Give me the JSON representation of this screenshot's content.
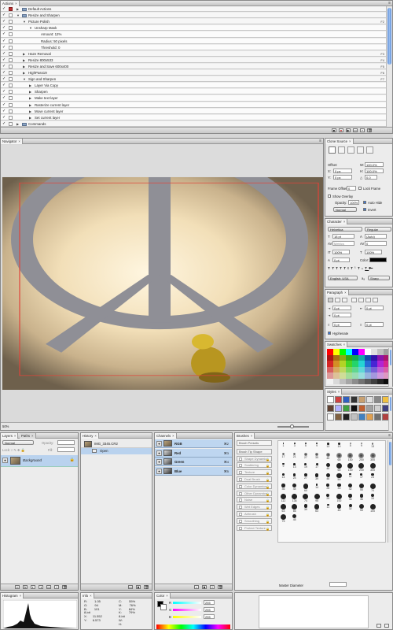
{
  "actions": {
    "tab": "Actions",
    "rows": [
      {
        "label": "Default Actions",
        "indent": 0,
        "type": "set",
        "key": ""
      },
      {
        "label": "Resize and Sharpen",
        "indent": 0,
        "type": "set",
        "key": ""
      },
      {
        "label": "Picture Polish",
        "indent": 1,
        "type": "action",
        "key": "F2"
      },
      {
        "label": "Unsharp Mask",
        "indent": 2,
        "type": "step",
        "key": ""
      },
      {
        "label": "Amount: 12%",
        "indent": 3,
        "type": "param",
        "key": ""
      },
      {
        "label": "Radius: 50 pixels",
        "indent": 3,
        "type": "param",
        "key": ""
      },
      {
        "label": "Threshold: 0",
        "indent": 3,
        "type": "param",
        "key": ""
      },
      {
        "label": "Haze Removal",
        "indent": 1,
        "type": "action",
        "key": "F3"
      },
      {
        "label": "Resize 800x533",
        "indent": 1,
        "type": "action",
        "key": "F4"
      },
      {
        "label": "Resize and Save 600x400",
        "indent": 1,
        "type": "action",
        "key": "F5"
      },
      {
        "label": "HighPass19",
        "indent": 1,
        "type": "action",
        "key": "F6"
      },
      {
        "label": "Sign and Sharpen",
        "indent": 1,
        "type": "action",
        "key": "F7"
      },
      {
        "label": "Layer Via Copy",
        "indent": 2,
        "type": "step",
        "key": ""
      },
      {
        "label": "Sharpen",
        "indent": 2,
        "type": "step",
        "key": ""
      },
      {
        "label": "Make text layer",
        "indent": 2,
        "type": "step",
        "key": ""
      },
      {
        "label": "Rasterize current layer",
        "indent": 2,
        "type": "step",
        "key": ""
      },
      {
        "label": "Move current layer",
        "indent": 2,
        "type": "step",
        "key": ""
      },
      {
        "label": "Set current layer",
        "indent": 2,
        "type": "step",
        "key": ""
      },
      {
        "label": "Commands",
        "indent": 0,
        "type": "set",
        "key": ""
      }
    ]
  },
  "document": {
    "tab": "Navigator",
    "zoom": "50%"
  },
  "clone_source": {
    "tab": "Clone Source",
    "offset_label": "Offset:",
    "x": "0 px",
    "y": "0 px",
    "w": "100.0%",
    "h": "100.0%",
    "angle": "0.0",
    "frame_offset_label": "Frame Offset:",
    "frame_offset": "0",
    "lock_frame": "Lock Frame",
    "show_overlay": "Show Overlay",
    "opacity_label": "Opacity:",
    "opacity": "100%",
    "auto_hide": "Auto Hide",
    "mode": "Normal",
    "invert": "Invert"
  },
  "character": {
    "tab": "Character",
    "font": "Helvetica",
    "style": "Regular",
    "size": "18 pt",
    "leading": "(Auto)",
    "kerning": "Metrics",
    "tracking": "0",
    "vscale": "100%",
    "hscale": "100%",
    "baseline": "0 pt",
    "color_label": "Color:",
    "language": "English: USA",
    "aa_label": "aₐ",
    "aa": "Sharp"
  },
  "paragraph": {
    "tab": "Paragraph",
    "left_indent": "0 pt",
    "right_indent": "0 pt",
    "first_indent": "0 pt",
    "space_before": "0 pt",
    "space_after": "0 pt",
    "hyphenate": "Hyphenate"
  },
  "swatches": {
    "tab": "Swatches"
  },
  "styles": {
    "tab": "Styles"
  },
  "layers": {
    "tabs": [
      "Layers",
      "Paths"
    ],
    "blend": "Normal",
    "opacity_label": "Opacity:",
    "opacity": "",
    "lock_label": "Lock:",
    "fill_label": "Fill:",
    "fill": "",
    "layer_name": "Background"
  },
  "history": {
    "tab": "History",
    "doc_name": "IMG_3345.CR2",
    "state": "Open"
  },
  "channels": {
    "tab": "Channels",
    "rows": [
      {
        "name": "RGB",
        "key": "⌘2"
      },
      {
        "name": "Red",
        "key": "⌘3"
      },
      {
        "name": "Green",
        "key": "⌘4"
      },
      {
        "name": "Blue",
        "key": "⌘5"
      }
    ]
  },
  "brushes": {
    "tab": "Brushes",
    "options": [
      "Brush Presets",
      "Brush Tip Shape",
      "Shape Dynamics",
      "Scattering",
      "Texture",
      "Dual Brush",
      "Color Dynamics",
      "Other Dynamics",
      "Noise",
      "Wet Edges",
      "Airbrush",
      "Smoothing",
      "Protect Texture"
    ],
    "master_diameter": "Master Diameter",
    "sizes": [
      "1",
      "3",
      "5",
      "9",
      "13",
      "19",
      "5",
      "9",
      "13",
      "17",
      "21",
      "27",
      "35",
      "45",
      "65",
      "100",
      "200",
      "300",
      "9",
      "13",
      "19",
      "17",
      "45",
      "65",
      "100",
      "200",
      "300",
      "14",
      "24",
      "27",
      "39",
      "46",
      "59",
      "11",
      "17",
      "23",
      "36",
      "44",
      "60",
      "14",
      "26",
      "33",
      "42",
      "55",
      "70",
      "112",
      "134",
      "74",
      "95",
      "29",
      "192",
      "36",
      "36",
      "33",
      "63",
      "66",
      "39",
      "63",
      "11",
      "48",
      "32",
      "55",
      "100",
      "75",
      "45"
    ]
  },
  "histogram": {
    "tab": "Histogram"
  },
  "info": {
    "tab": "Info",
    "lines": [
      "R:",
      "G:",
      "B:",
      "8-bit",
      "X:",
      "Y:"
    ],
    "vals": [
      "1.05",
      "94",
      "101",
      "",
      "11.552",
      "6.573"
    ],
    "lines2": [
      "C:",
      "M:",
      "Y:",
      "K:",
      "8-bit",
      "W:",
      "H:"
    ],
    "vals2": [
      "55%",
      "76%",
      "84%",
      "79%",
      "",
      "",
      ""
    ]
  },
  "color": {
    "tab": "Color",
    "r": "255",
    "g": "255",
    "b": "255"
  },
  "colors": {
    "accent": "#b9d2ee",
    "selection_rect": "#e0443a",
    "panel_bg": "#ececec"
  }
}
